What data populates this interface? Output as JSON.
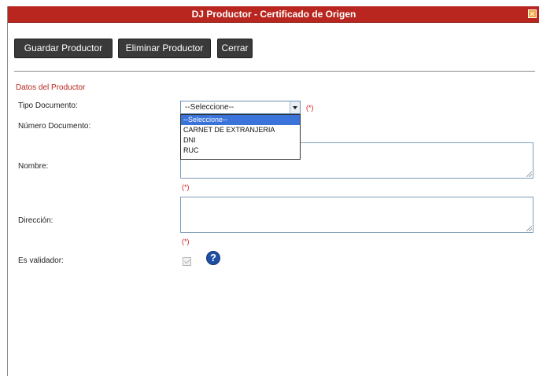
{
  "window": {
    "title": "DJ Productor - Certificado de Origen"
  },
  "toolbar": {
    "save_label": "Guardar Productor",
    "delete_label": "Eliminar Productor",
    "close_label": "Cerrar"
  },
  "section": {
    "title": "Datos del Productor"
  },
  "form": {
    "tipo_documento": {
      "label": "Tipo Documento:",
      "selected": "--Seleccione--",
      "options": [
        "--Seleccione--",
        "CARNET DE EXTRANJERIA",
        "DNI",
        "RUC"
      ],
      "required_marker": "(*)"
    },
    "numero_documento": {
      "label": "Número Documento:"
    },
    "nombre": {
      "label": "Nombre:",
      "required_marker": "(*)"
    },
    "direccion": {
      "label": "Dirección:",
      "required_marker": "(*)"
    },
    "es_validador": {
      "label": "Es validador:",
      "help_icon": "question-icon"
    }
  },
  "colors": {
    "titlebar": "#b8261f",
    "section_title": "#b8261f",
    "button_bg": "#3a3a3a",
    "selected_option": "#3a73d9",
    "help_icon": "#1f4fa3"
  }
}
